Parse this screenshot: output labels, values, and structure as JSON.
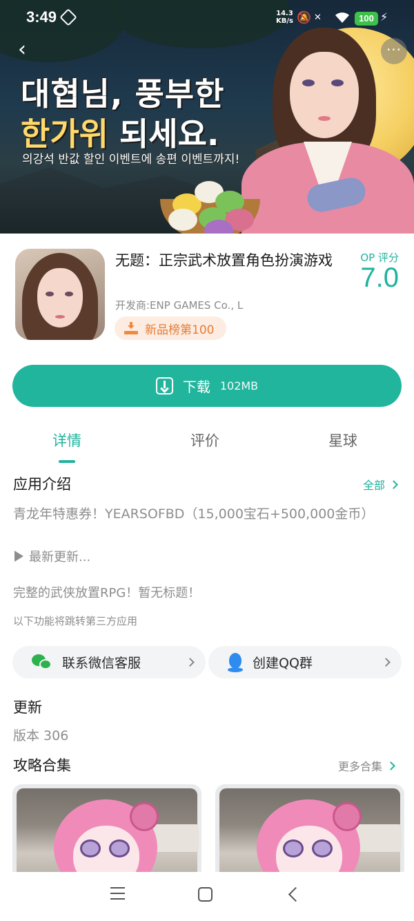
{
  "status_bar": {
    "time": "3:49",
    "speed_value": "14.3",
    "speed_unit": "KB/s",
    "battery": "100",
    "icons": [
      "settings-icon",
      "mute-icon",
      "no-signal-icon",
      "wifi-icon",
      "battery-icon",
      "charging-icon"
    ]
  },
  "banner": {
    "headline_line1": "대협님, 풍부한",
    "headline_line2_gold": "한가위",
    "headline_line2_white": " 되세요.",
    "subtitle": "의강석 반값 할인 이벤트에 송편 이벤트까지!",
    "more_label": "···"
  },
  "app": {
    "title": "无题：正宗武术放置角色扮演游戏",
    "developer": "开发商:ENP GAMES Co., L",
    "rank_badge": "新品榜第100",
    "score_label": "OP 评分",
    "score": "7.0"
  },
  "download": {
    "label": "下载",
    "size": "102MB"
  },
  "tabs": [
    {
      "label": "详情",
      "active": true
    },
    {
      "label": "评价",
      "active": false
    },
    {
      "label": "星球",
      "active": false
    }
  ],
  "intro": {
    "title": "应用介绍",
    "more": "全部",
    "description": "青龙年特惠券！YEARSOFBD（15,000宝石+500,000金币）",
    "update_toggle": "最新更新...",
    "summary": "完整的武侠放置RPG！暂无标题！",
    "third_party_note": "以下功能将跳转第三方应用"
  },
  "third_party": [
    {
      "label": "联系微信客服",
      "icon": "wechat-icon"
    },
    {
      "label": "创建QQ群",
      "icon": "qq-icon"
    }
  ],
  "update": {
    "title": "更新",
    "version": "版本 306"
  },
  "guides": {
    "title": "攻略合集",
    "more": "更多合集"
  },
  "colors": {
    "accent": "#1fb39c",
    "download_button": "#22b59e",
    "rank_text": "#e77c34",
    "rank_bg": "#fdece2"
  }
}
